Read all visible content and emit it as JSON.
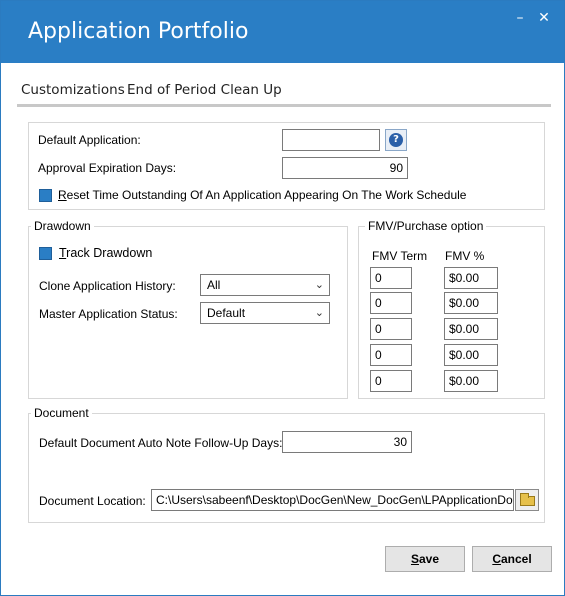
{
  "window": {
    "title": "Application Portfolio",
    "minimize": "–",
    "close": "✕"
  },
  "tabs": [
    {
      "label": "Customizations"
    },
    {
      "label": "End of Period Clean Up"
    }
  ],
  "general": {
    "default_application_label": "Default Application:",
    "default_application_value": "",
    "help_icon": "?",
    "approval_expiration_label": "Approval Expiration Days:",
    "approval_expiration_value": "90",
    "reset_time_label": "Reset Time Outstanding Of An Application Appearing On The Work Schedule",
    "reset_time_checked": true
  },
  "drawdown": {
    "legend": "Drawdown",
    "track_label": "Track Drawdown",
    "track_checked": true,
    "clone_history_label": "Clone Application History:",
    "clone_history_value": "All",
    "master_status_label": "Master Application Status:",
    "master_status_value": "Default"
  },
  "fmv": {
    "legend": "FMV/Purchase option",
    "term_header": "FMV Term",
    "pct_header": "FMV %",
    "rows": [
      {
        "term": "0",
        "pct": "$0.00"
      },
      {
        "term": "0",
        "pct": "$0.00"
      },
      {
        "term": "0",
        "pct": "$0.00"
      },
      {
        "term": "0",
        "pct": "$0.00"
      },
      {
        "term": "0",
        "pct": "$0.00"
      }
    ]
  },
  "document": {
    "legend": "Document",
    "follow_up_label": "Default Document Auto Note Follow-Up Days:",
    "follow_up_value": "30",
    "location_label": "Document Location:",
    "location_value": "C:\\Users\\sabeenf\\Desktop\\DocGen\\New_DocGen\\LPApplicationDo"
  },
  "buttons": {
    "save": "Save",
    "cancel": "Cancel"
  },
  "colors": {
    "accent": "#2a7ec5"
  }
}
